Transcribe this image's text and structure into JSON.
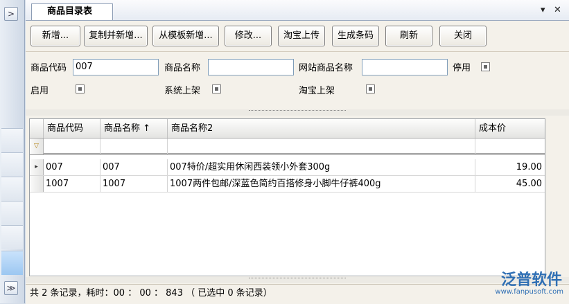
{
  "window": {
    "tab_title": "商品目录表",
    "tab_menu": "▾",
    "tab_close": "✕"
  },
  "leftbar": {
    "top_button": ">",
    "bottom_button": "≫"
  },
  "toolbar": {
    "buttons": [
      "新增...",
      "复制并新增...",
      "从模板新增...",
      "修改...",
      "淘宝上传",
      "生成条码",
      "刷新",
      "关闭"
    ]
  },
  "filters": {
    "code_label": "商品代码",
    "code_value": "007",
    "name_label": "商品名称",
    "name_value": "",
    "site_name_label": "网站商品名称",
    "site_name_value": "",
    "disabled_label": "停用",
    "enabled_label": "启用",
    "system_listed_label": "系统上架",
    "taobao_listed_label": "淘宝上架"
  },
  "grid": {
    "columns": [
      "商品代码",
      "商品名称 ↑",
      "商品名称2",
      "成本价"
    ],
    "filter_icon": "▽",
    "rows": [
      {
        "indicator": "▸",
        "code": "007",
        "name": "007",
        "name2": "007特价/超实用休闲西装领小外套300g",
        "cost": "19.00"
      },
      {
        "indicator": "",
        "code": "1007",
        "name": "1007",
        "name2": "1007两件包邮/深蓝色简约百搭修身小脚牛仔裤400g",
        "cost": "45.00"
      }
    ]
  },
  "status": {
    "text": "共 2 条记录，耗时：00 ： 00 ： 843 （ 已选中 0 条记录）"
  },
  "brand": {
    "name": "泛普软件",
    "url": "www.fanpusoft.com"
  }
}
